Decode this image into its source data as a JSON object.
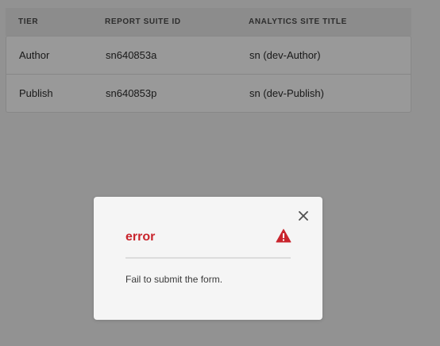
{
  "table": {
    "headers": [
      "TIER",
      "REPORT SUITE ID",
      "ANALYTICS SITE TITLE"
    ],
    "rows": [
      [
        "Author",
        "sn640853a",
        "sn (dev-Author)"
      ],
      [
        "Publish",
        "sn640853p",
        "sn (dev-Publish)"
      ]
    ]
  },
  "dialog": {
    "title": "error",
    "message": "Fail to submit the form.",
    "icons": {
      "close": "close-icon",
      "alert": "alert-icon"
    }
  },
  "colors": {
    "error": "#c9252d",
    "overlay": "rgba(0,0,0,0.4)",
    "dialog_bg": "#f5f5f5"
  }
}
